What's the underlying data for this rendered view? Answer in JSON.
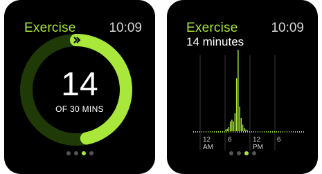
{
  "colors": {
    "accent": "#a9e83a",
    "ring_track": "#1f3a06",
    "background": "#000000"
  },
  "watch1": {
    "title": "Exercise",
    "time": "10:09",
    "value": "14",
    "goal_label": "OF 30 MINS",
    "progress_fraction": 0.467,
    "ring_icon": "arrow-icon",
    "page_indicator": {
      "count": 4,
      "active": 2
    }
  },
  "watch2": {
    "title": "Exercise",
    "time": "10:09",
    "subtitle": "14 minutes",
    "page_indicator": {
      "count": 4,
      "active": 2
    },
    "chart_data": {
      "type": "bar",
      "x_ticks": [
        {
          "line1": "12",
          "line2": "AM"
        },
        {
          "line1": "6",
          "line2": ""
        },
        {
          "line1": "12",
          "line2": "PM"
        },
        {
          "line1": "6",
          "line2": ""
        }
      ],
      "values": [
        0,
        0,
        0,
        0,
        0,
        0,
        0,
        0,
        0,
        0,
        0,
        0,
        0,
        0,
        0,
        0,
        2,
        3,
        5,
        12,
        14,
        12,
        22,
        65,
        100,
        30,
        16,
        8,
        4,
        2,
        1,
        0,
        0,
        0,
        0,
        0,
        0,
        0,
        0,
        0,
        0,
        0,
        0,
        0,
        0,
        0,
        0,
        0,
        0,
        0,
        0,
        0,
        0,
        0,
        0,
        0,
        0,
        0,
        0,
        0,
        0,
        0,
        0,
        0,
        0,
        0,
        0
      ]
    }
  }
}
